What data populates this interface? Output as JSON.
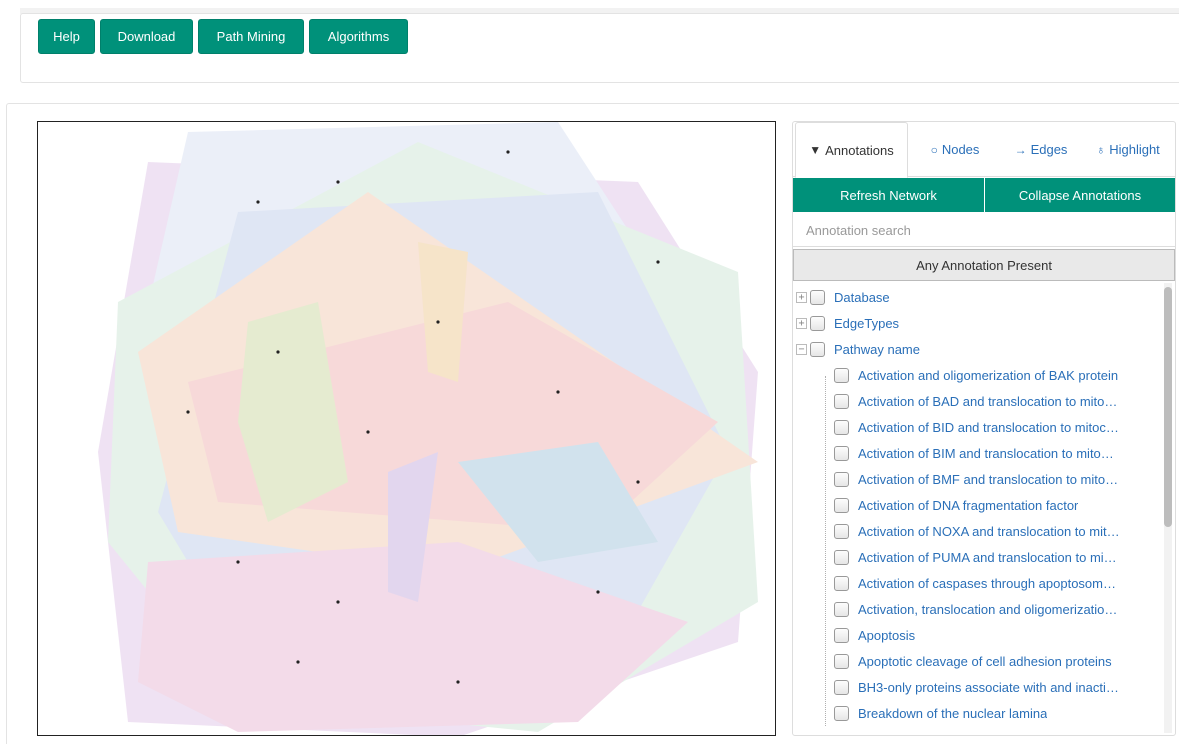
{
  "toolbar": {
    "buttons": [
      "Help",
      "Download",
      "Path Mining",
      "Algorithms"
    ]
  },
  "side_panel": {
    "tabs": [
      {
        "label": "Annotations",
        "icon": "filter-icon"
      },
      {
        "label": "Nodes",
        "icon": "circle-icon"
      },
      {
        "label": "Edges",
        "icon": "arrow-right-icon"
      },
      {
        "label": "Highlight",
        "icon": "lightbulb-icon"
      }
    ],
    "refresh_label": "Refresh Network",
    "collapse_label": "Collapse Annotations",
    "search_placeholder": "Annotation search",
    "any_annotation_label": "Any Annotation Present",
    "tree": {
      "groups": [
        {
          "label": "Database",
          "expander": "+"
        },
        {
          "label": "EdgeTypes",
          "expander": "+"
        },
        {
          "label": "Pathway name",
          "expander": "−"
        }
      ],
      "pathway_items": [
        "Activation and oligomerization of BAK protein",
        "Activation of BAD and translocation to mito…",
        "Activation of BID and translocation to mitoc…",
        "Activation of BIM and translocation to mito…",
        "Activation of BMF and translocation to mito…",
        "Activation of DNA fragmentation factor",
        "Activation of NOXA and translocation to mit…",
        "Activation of PUMA and translocation to mi…",
        "Activation of caspases through apoptosom…",
        "Activation, translocation and oligomerizatio…",
        "Apoptosis",
        "Apoptotic cleavage of cell adhesion proteins",
        "BH3-only proteins associate with and inacti…",
        "Breakdown of the nuclear lamina"
      ]
    }
  },
  "colors": {
    "accent": "#00917a",
    "link": "#2a6fb8"
  }
}
